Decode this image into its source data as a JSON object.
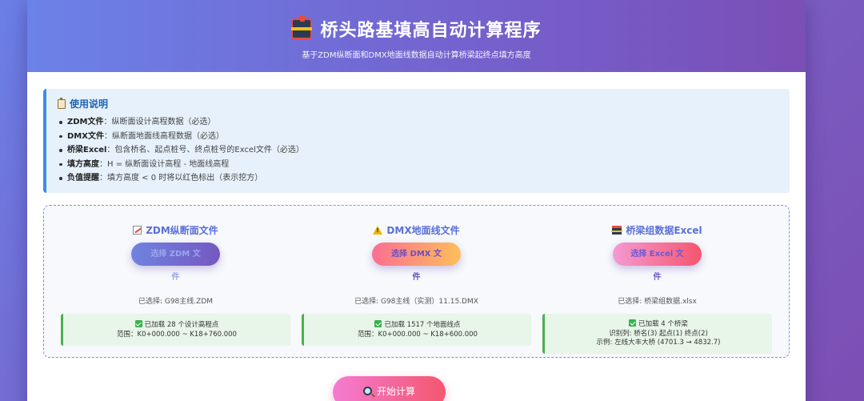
{
  "header": {
    "title": "桥头路基填高自动计算程序",
    "subtitle": "基于ZDM纵断面和DMX地面线数据自动计算桥梁起终点填方高度"
  },
  "info": {
    "title": "使用说明",
    "items": [
      {
        "label": "ZDM文件",
        "text": "：纵断面设计高程数据（必选）"
      },
      {
        "label": "DMX文件",
        "text": "：纵断面地面线高程数据（必选）"
      },
      {
        "label": "桥梁Excel",
        "text": "：包含桥名、起点桩号、终点桩号的Excel文件（必选）"
      },
      {
        "label": "填方高度",
        "text": "：H = 纵断面设计高程 - 地面线高程"
      },
      {
        "label": "负值提醒",
        "text": "：填方高度 < 0 时将以红色标出（表示挖方）"
      }
    ]
  },
  "columns": [
    {
      "icon": "chart-icon",
      "title": "ZDM纵断面文件",
      "button": "选择 ZDM 文件",
      "selected": "已选择: G98主线.ZDM",
      "status_line1": "已加载 28 个设计高程点",
      "status_line2": "范围：K0+000.000 ~ K18+760.000",
      "status_line3": ""
    },
    {
      "icon": "warning-icon",
      "title": "DMX地面线文件",
      "button": "选择 DMX 文件",
      "selected": "已选择: G98主线（实测）11.15.DMX",
      "status_line1": "已加载 1517 个地面线点",
      "status_line2": "范围：K0+000.000 ~ K18+600.000",
      "status_line3": ""
    },
    {
      "icon": "bridge-icon",
      "title": "桥梁组数据Excel",
      "button": "选择 Excel 文件",
      "selected": "已选择: 桥梁组数据.xlsx",
      "status_line1": "已加载 4 个桥梁",
      "status_line2": "识别列: 桥名(3) 起点(1) 终点(2)",
      "status_line3": "示例: 左线大丰大桥 (4701.3 → 4832.7)"
    }
  ],
  "actions": {
    "start_label": "开始计算"
  }
}
